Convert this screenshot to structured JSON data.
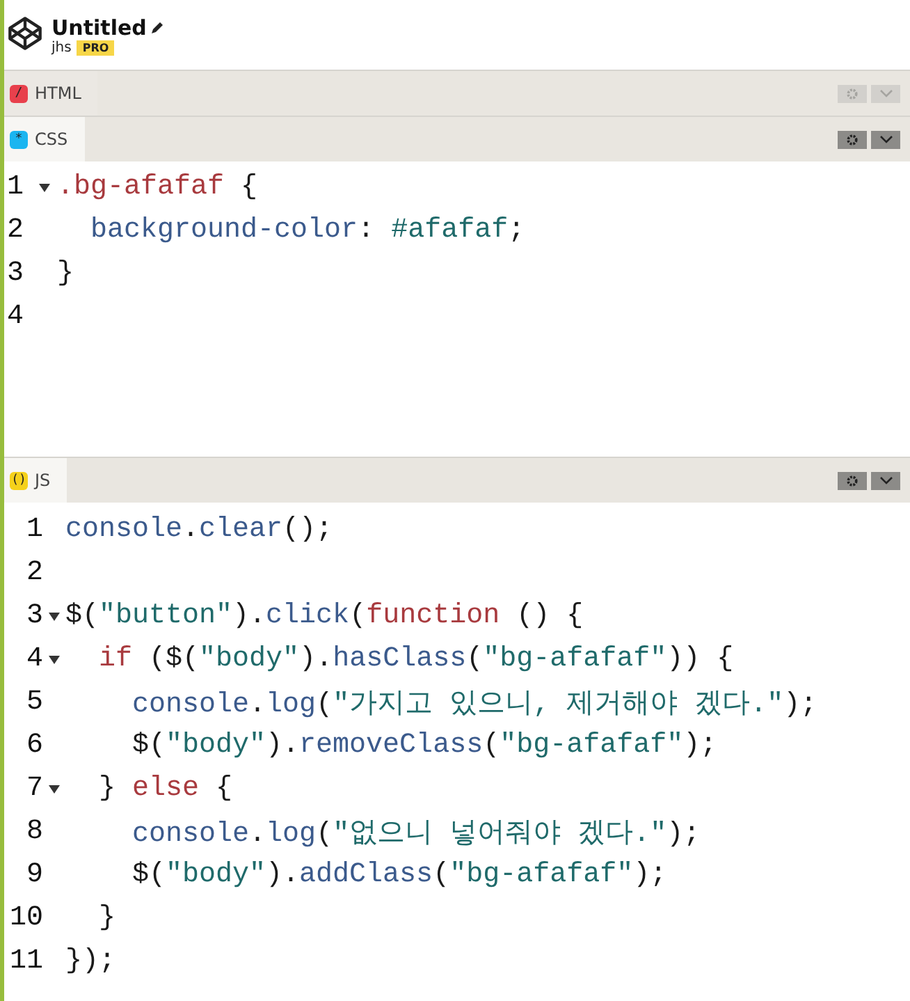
{
  "header": {
    "title": "Untitled",
    "user": "jhs",
    "badge": "PRO"
  },
  "panes": [
    {
      "label": "HTML",
      "kind": "html",
      "icon": "/",
      "selected": false
    },
    {
      "label": "CSS",
      "kind": "css",
      "icon": "*",
      "selected": true,
      "lines": [
        {
          "number": "1",
          "fold": true,
          "tokens": [
            {
              "kind": "kw",
              "text": ".bg-afafaf"
            },
            {
              "kind": "plain",
              "text": " {"
            }
          ]
        },
        {
          "number": "2",
          "fold": false,
          "tokens": [
            {
              "kind": "prop",
              "text": "  background-color"
            },
            {
              "kind": "plain",
              "text": ": "
            },
            {
              "kind": "str",
              "text": "#afafaf"
            },
            {
              "kind": "plain",
              "text": ";"
            }
          ]
        },
        {
          "number": "3",
          "fold": false,
          "tokens": [
            {
              "kind": "plain",
              "text": "}"
            }
          ]
        },
        {
          "number": "4",
          "fold": false
        }
      ]
    },
    {
      "label": "JS",
      "kind": "js",
      "icon": "()",
      "selected": true,
      "lines": [
        {
          "number": "1",
          "fold": false,
          "tokens": [
            {
              "kind": "prop",
              "text": "console"
            },
            {
              "kind": "plain",
              "text": "."
            },
            {
              "kind": "prop",
              "text": "clear"
            },
            {
              "kind": "plain",
              "text": "();"
            }
          ]
        },
        {
          "number": "2",
          "fold": false
        },
        {
          "number": "3",
          "fold": true,
          "tokens": [
            {
              "kind": "plain",
              "text": "$("
            },
            {
              "kind": "str",
              "text": "\"button\""
            },
            {
              "kind": "plain",
              "text": ")."
            },
            {
              "kind": "prop",
              "text": "click"
            },
            {
              "kind": "plain",
              "text": "("
            },
            {
              "kind": "kw",
              "text": "function"
            },
            {
              "kind": "plain",
              "text": " () {"
            }
          ]
        },
        {
          "number": "4",
          "fold": true,
          "tokens": [
            {
              "kind": "kw",
              "text": "  if"
            },
            {
              "kind": "plain",
              "text": " ($("
            },
            {
              "kind": "str",
              "text": "\"body\""
            },
            {
              "kind": "plain",
              "text": ")."
            },
            {
              "kind": "prop",
              "text": "hasClass"
            },
            {
              "kind": "plain",
              "text": "("
            },
            {
              "kind": "str",
              "text": "\"bg-afafaf\""
            },
            {
              "kind": "plain",
              "text": ")) {"
            }
          ]
        },
        {
          "number": "5",
          "fold": false,
          "tokens": [
            {
              "kind": "prop",
              "text": "    console"
            },
            {
              "kind": "plain",
              "text": "."
            },
            {
              "kind": "prop",
              "text": "log"
            },
            {
              "kind": "plain",
              "text": "("
            },
            {
              "kind": "str",
              "text": "\"가지고 있으니, 제거해야 겠다.\""
            },
            {
              "kind": "plain",
              "text": ");"
            }
          ]
        },
        {
          "number": "6",
          "fold": false,
          "tokens": [
            {
              "kind": "plain",
              "text": "    $("
            },
            {
              "kind": "str",
              "text": "\"body\""
            },
            {
              "kind": "plain",
              "text": ")."
            },
            {
              "kind": "prop",
              "text": "removeClass"
            },
            {
              "kind": "plain",
              "text": "("
            },
            {
              "kind": "str",
              "text": "\"bg-afafaf\""
            },
            {
              "kind": "plain",
              "text": ");"
            }
          ]
        },
        {
          "number": "7",
          "fold": true,
          "tokens": [
            {
              "kind": "plain",
              "text": "  } "
            },
            {
              "kind": "kw",
              "text": "else"
            },
            {
              "kind": "plain",
              "text": " {"
            }
          ]
        },
        {
          "number": "8",
          "fold": false,
          "tokens": [
            {
              "kind": "prop",
              "text": "    console"
            },
            {
              "kind": "plain",
              "text": "."
            },
            {
              "kind": "prop",
              "text": "log"
            },
            {
              "kind": "plain",
              "text": "("
            },
            {
              "kind": "str",
              "text": "\"없으니 넣어줘야 겠다.\""
            },
            {
              "kind": "plain",
              "text": ");"
            }
          ]
        },
        {
          "number": "9",
          "fold": false,
          "tokens": [
            {
              "kind": "plain",
              "text": "    $("
            },
            {
              "kind": "str",
              "text": "\"body\""
            },
            {
              "kind": "plain",
              "text": ")."
            },
            {
              "kind": "prop",
              "text": "addClass"
            },
            {
              "kind": "plain",
              "text": "("
            },
            {
              "kind": "str",
              "text": "\"bg-afafaf\""
            },
            {
              "kind": "plain",
              "text": ");"
            }
          ]
        },
        {
          "number": "10",
          "fold": false,
          "tokens": [
            {
              "kind": "plain",
              "text": "  }"
            }
          ]
        },
        {
          "number": "11",
          "fold": false,
          "tokens": [
            {
              "kind": "plain",
              "text": "});"
            }
          ]
        }
      ]
    }
  ]
}
